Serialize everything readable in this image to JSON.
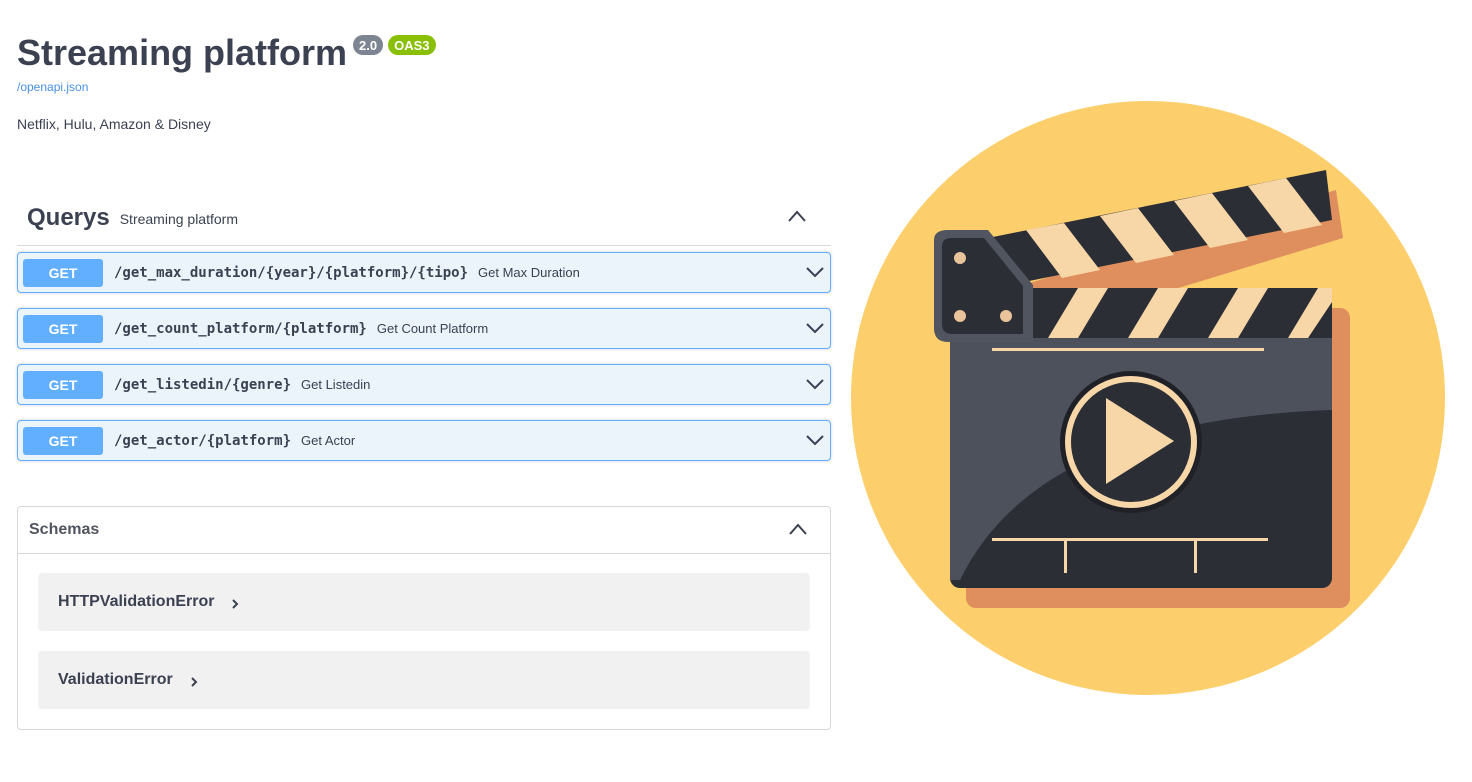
{
  "info": {
    "title": "Streaming platform",
    "version": "2.0",
    "oas_badge": "OAS3",
    "spec_link": "/openapi.json",
    "description": "Netflix, Hulu, Amazon & Disney"
  },
  "tag": {
    "name": "Querys",
    "description": "Streaming platform"
  },
  "operations": [
    {
      "method": "GET",
      "path": "/get_max_duration/{year}/{platform}/{tipo}",
      "summary": "Get Max Duration"
    },
    {
      "method": "GET",
      "path": "/get_count_platform/{platform}",
      "summary": "Get Count Platform"
    },
    {
      "method": "GET",
      "path": "/get_listedin/{genre}",
      "summary": "Get Listedin"
    },
    {
      "method": "GET",
      "path": "/get_actor/{platform}",
      "summary": "Get Actor"
    }
  ],
  "schemas": {
    "title": "Schemas",
    "items": [
      "HTTPValidationError",
      "ValidationError"
    ]
  },
  "colors": {
    "get_accent": "#61affe",
    "get_background": "#ebf3fb",
    "version_badge": "#7d8492",
    "oas_badge": "#89bf04",
    "illustration_circle": "#fccf6c"
  },
  "icons": [
    "chevron-up-icon",
    "chevron-down-icon",
    "chevron-right-icon",
    "clapperboard-play-illustration"
  ]
}
